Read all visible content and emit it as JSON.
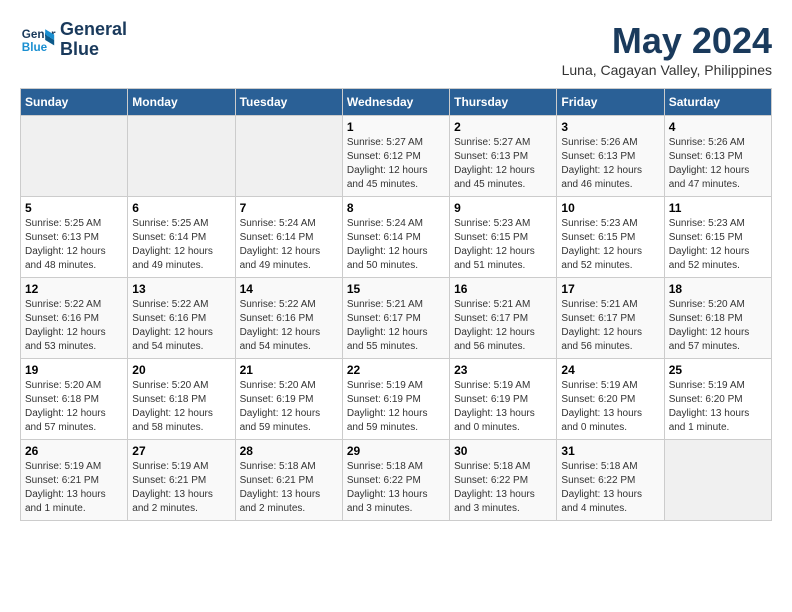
{
  "header": {
    "logo_line1": "General",
    "logo_line2": "Blue",
    "title": "May 2024",
    "subtitle": "Luna, Cagayan Valley, Philippines"
  },
  "calendar": {
    "days_of_week": [
      "Sunday",
      "Monday",
      "Tuesday",
      "Wednesday",
      "Thursday",
      "Friday",
      "Saturday"
    ],
    "weeks": [
      [
        {
          "day": "",
          "info": ""
        },
        {
          "day": "",
          "info": ""
        },
        {
          "day": "",
          "info": ""
        },
        {
          "day": "1",
          "info": "Sunrise: 5:27 AM\nSunset: 6:12 PM\nDaylight: 12 hours\nand 45 minutes."
        },
        {
          "day": "2",
          "info": "Sunrise: 5:27 AM\nSunset: 6:13 PM\nDaylight: 12 hours\nand 45 minutes."
        },
        {
          "day": "3",
          "info": "Sunrise: 5:26 AM\nSunset: 6:13 PM\nDaylight: 12 hours\nand 46 minutes."
        },
        {
          "day": "4",
          "info": "Sunrise: 5:26 AM\nSunset: 6:13 PM\nDaylight: 12 hours\nand 47 minutes."
        }
      ],
      [
        {
          "day": "5",
          "info": "Sunrise: 5:25 AM\nSunset: 6:13 PM\nDaylight: 12 hours\nand 48 minutes."
        },
        {
          "day": "6",
          "info": "Sunrise: 5:25 AM\nSunset: 6:14 PM\nDaylight: 12 hours\nand 49 minutes."
        },
        {
          "day": "7",
          "info": "Sunrise: 5:24 AM\nSunset: 6:14 PM\nDaylight: 12 hours\nand 49 minutes."
        },
        {
          "day": "8",
          "info": "Sunrise: 5:24 AM\nSunset: 6:14 PM\nDaylight: 12 hours\nand 50 minutes."
        },
        {
          "day": "9",
          "info": "Sunrise: 5:23 AM\nSunset: 6:15 PM\nDaylight: 12 hours\nand 51 minutes."
        },
        {
          "day": "10",
          "info": "Sunrise: 5:23 AM\nSunset: 6:15 PM\nDaylight: 12 hours\nand 52 minutes."
        },
        {
          "day": "11",
          "info": "Sunrise: 5:23 AM\nSunset: 6:15 PM\nDaylight: 12 hours\nand 52 minutes."
        }
      ],
      [
        {
          "day": "12",
          "info": "Sunrise: 5:22 AM\nSunset: 6:16 PM\nDaylight: 12 hours\nand 53 minutes."
        },
        {
          "day": "13",
          "info": "Sunrise: 5:22 AM\nSunset: 6:16 PM\nDaylight: 12 hours\nand 54 minutes."
        },
        {
          "day": "14",
          "info": "Sunrise: 5:22 AM\nSunset: 6:16 PM\nDaylight: 12 hours\nand 54 minutes."
        },
        {
          "day": "15",
          "info": "Sunrise: 5:21 AM\nSunset: 6:17 PM\nDaylight: 12 hours\nand 55 minutes."
        },
        {
          "day": "16",
          "info": "Sunrise: 5:21 AM\nSunset: 6:17 PM\nDaylight: 12 hours\nand 56 minutes."
        },
        {
          "day": "17",
          "info": "Sunrise: 5:21 AM\nSunset: 6:17 PM\nDaylight: 12 hours\nand 56 minutes."
        },
        {
          "day": "18",
          "info": "Sunrise: 5:20 AM\nSunset: 6:18 PM\nDaylight: 12 hours\nand 57 minutes."
        }
      ],
      [
        {
          "day": "19",
          "info": "Sunrise: 5:20 AM\nSunset: 6:18 PM\nDaylight: 12 hours\nand 57 minutes."
        },
        {
          "day": "20",
          "info": "Sunrise: 5:20 AM\nSunset: 6:18 PM\nDaylight: 12 hours\nand 58 minutes."
        },
        {
          "day": "21",
          "info": "Sunrise: 5:20 AM\nSunset: 6:19 PM\nDaylight: 12 hours\nand 59 minutes."
        },
        {
          "day": "22",
          "info": "Sunrise: 5:19 AM\nSunset: 6:19 PM\nDaylight: 12 hours\nand 59 minutes."
        },
        {
          "day": "23",
          "info": "Sunrise: 5:19 AM\nSunset: 6:19 PM\nDaylight: 13 hours\nand 0 minutes."
        },
        {
          "day": "24",
          "info": "Sunrise: 5:19 AM\nSunset: 6:20 PM\nDaylight: 13 hours\nand 0 minutes."
        },
        {
          "day": "25",
          "info": "Sunrise: 5:19 AM\nSunset: 6:20 PM\nDaylight: 13 hours\nand 1 minute."
        }
      ],
      [
        {
          "day": "26",
          "info": "Sunrise: 5:19 AM\nSunset: 6:21 PM\nDaylight: 13 hours\nand 1 minute."
        },
        {
          "day": "27",
          "info": "Sunrise: 5:19 AM\nSunset: 6:21 PM\nDaylight: 13 hours\nand 2 minutes."
        },
        {
          "day": "28",
          "info": "Sunrise: 5:18 AM\nSunset: 6:21 PM\nDaylight: 13 hours\nand 2 minutes."
        },
        {
          "day": "29",
          "info": "Sunrise: 5:18 AM\nSunset: 6:22 PM\nDaylight: 13 hours\nand 3 minutes."
        },
        {
          "day": "30",
          "info": "Sunrise: 5:18 AM\nSunset: 6:22 PM\nDaylight: 13 hours\nand 3 minutes."
        },
        {
          "day": "31",
          "info": "Sunrise: 5:18 AM\nSunset: 6:22 PM\nDaylight: 13 hours\nand 4 minutes."
        },
        {
          "day": "",
          "info": ""
        }
      ]
    ]
  }
}
